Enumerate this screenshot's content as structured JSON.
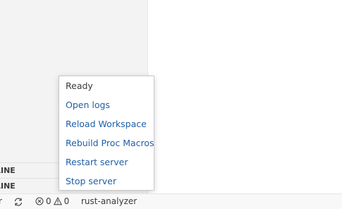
{
  "sidebar": {
    "sections": [
      {
        "label": "LINE"
      },
      {
        "label": "LINE"
      }
    ]
  },
  "rust_analyzer_menu": {
    "status": "Ready",
    "actions": [
      {
        "label": "Open logs"
      },
      {
        "label": "Reload Workspace"
      },
      {
        "label": "Rebuild Proc Macros"
      },
      {
        "label": "Restart server"
      },
      {
        "label": "Stop server"
      }
    ]
  },
  "statusbar": {
    "branch_tail": "r",
    "errors": "0",
    "warnings": "0",
    "rust_analyzer": "rust-analyzer"
  },
  "icons": {
    "sync": "sync-icon",
    "error": "error-icon",
    "warning": "warning-icon"
  },
  "colors": {
    "link": "#1f5fa8",
    "statusbar_bg": "#f8f8f8",
    "sidebar_bg": "#f3f3f3"
  }
}
